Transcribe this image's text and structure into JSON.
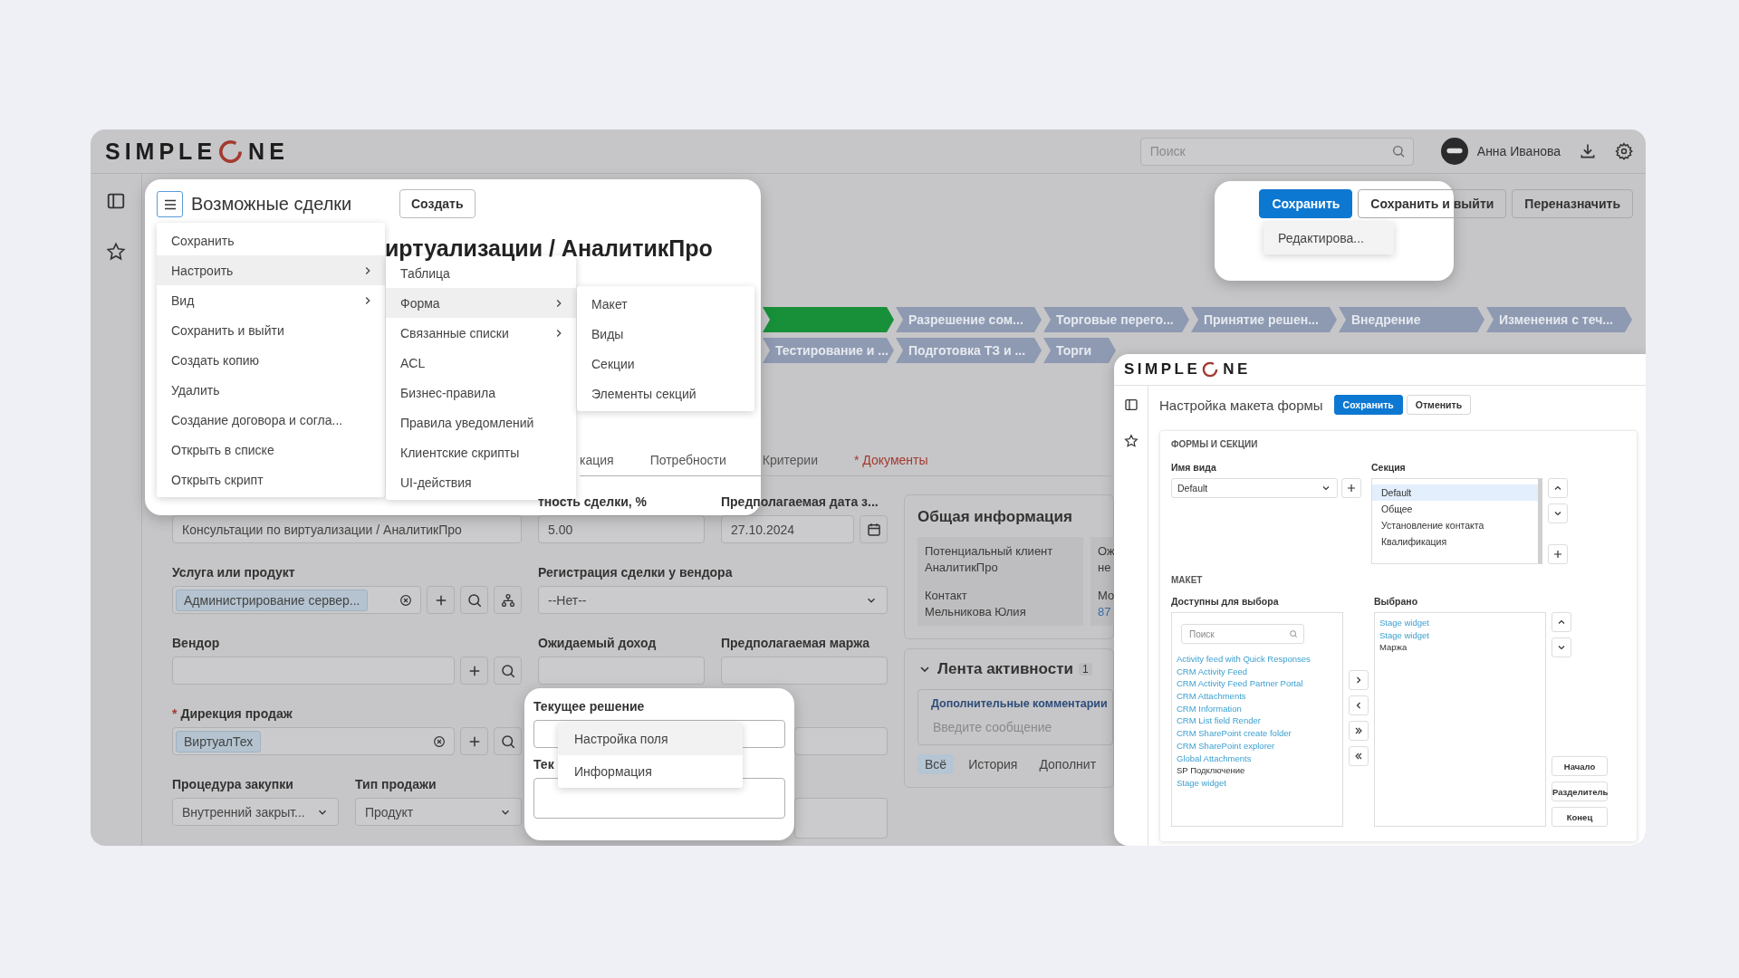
{
  "header": {
    "logo_start": "SIMPLE",
    "logo_end": "NE",
    "search_placeholder": "Поиск",
    "user_name": "Анна Иванова"
  },
  "page": {
    "title": "Возможные сделки",
    "create_button": "Создать",
    "record_title": "иртуализации / АналитикПро"
  },
  "menu": [
    {
      "label": "Сохранить",
      "selected": false,
      "submenu": false
    },
    {
      "label": "Настроить",
      "selected": true,
      "submenu": true,
      "children": [
        {
          "label": "Таблица",
          "selected": false,
          "submenu": false
        },
        {
          "label": "Форма",
          "selected": true,
          "submenu": true,
          "children": [
            {
              "label": "Макет",
              "selected": false
            },
            {
              "label": "Виды",
              "selected": false
            },
            {
              "label": "Секции",
              "selected": false
            },
            {
              "label": "Элементы секций",
              "selected": false
            }
          ]
        },
        {
          "label": "Связанные списки",
          "selected": false,
          "submenu": true
        },
        {
          "label": "ACL",
          "selected": false,
          "submenu": false
        },
        {
          "label": "Бизнес-правила",
          "selected": false,
          "submenu": false
        },
        {
          "label": "Правила уведомлений",
          "selected": false,
          "submenu": false
        },
        {
          "label": "Клиентские скрипты",
          "selected": false,
          "submenu": false
        },
        {
          "label": "UI-действия",
          "selected": false,
          "submenu": false
        }
      ]
    },
    {
      "label": "Вид",
      "selected": false,
      "submenu": true
    },
    {
      "label": "Сохранить и выйти",
      "selected": false,
      "submenu": false
    },
    {
      "label": "Создать копию",
      "selected": false,
      "submenu": false
    },
    {
      "label": "Удалить",
      "selected": false,
      "submenu": false
    },
    {
      "label": "Создание договора и согла...",
      "selected": false,
      "submenu": false
    },
    {
      "label": "Открыть в списке",
      "selected": false,
      "submenu": false
    },
    {
      "label": "Открыть скрипт",
      "selected": false,
      "submenu": false
    }
  ],
  "actions": {
    "buttons": [
      {
        "label": "Сохранить",
        "primary": true
      },
      {
        "label": "Сохранить и выйти",
        "primary": false
      },
      {
        "label": "Переназначить",
        "primary": false
      }
    ],
    "dropdown": [
      {
        "label": "Редактирова..."
      }
    ]
  },
  "stages": [
    [
      {
        "done": true
      },
      {
        "label": "Разрешение сом...",
        "done": false
      },
      {
        "label": "Торговые перего...",
        "done": false
      },
      {
        "label": "Принятие решен...",
        "done": false
      },
      {
        "label": "Внедрение",
        "done": false
      },
      {
        "label": "Изменения с теч...",
        "done": false
      }
    ],
    [
      {
        "label": "Тестирование и ...",
        "done": false
      },
      {
        "label": "Подготовка ТЗ и ...",
        "done": false
      },
      {
        "label": "Торги",
        "done": false
      }
    ]
  ],
  "tabs": [
    {
      "label": "кация",
      "required": false
    },
    {
      "label": "Потребности",
      "required": false
    },
    {
      "label": "Критерии",
      "required": false
    },
    {
      "label": "Документы",
      "required": true,
      "required_mark": "*"
    }
  ],
  "form": {
    "name": {
      "value": "Консультации по виртуализации / АналитикПро"
    },
    "probability": {
      "label": "тность сделки, %",
      "value": "5.00"
    },
    "close_date": {
      "label": "Предполагаемая дата з...",
      "value": "27.10.2024"
    },
    "service": {
      "label": "Услуга или продукт",
      "chip": "Администрирование сервер..."
    },
    "vendor_registration": {
      "label": "Регистрация сделки у вендора",
      "value": "--Нет--"
    },
    "vendor": {
      "label": "Вендор"
    },
    "expected_income": {
      "label": "Ожидаемый доход"
    },
    "margin": {
      "label": "Предполагаемая маржа"
    },
    "sales_direction": {
      "label": "Дирекция продаж",
      "required_mark": "*",
      "chip": "ВиртуалТех"
    },
    "procurement": {
      "label": "Процедура закупки",
      "value": "Внутренний закрыт..."
    },
    "sale_type": {
      "label": "Тип продажи",
      "value": "Продукт"
    }
  },
  "field_popup": {
    "label": "Текущее решение",
    "menu": [
      {
        "label": "Настройка поля",
        "selected": true
      },
      {
        "label": "Информация",
        "selected": false
      }
    ],
    "next_label": "Тек"
  },
  "general_info": {
    "title": "Общая информация",
    "cells": [
      {
        "label": "Потенциальный клиент",
        "value": "АналитикПро",
        "link": false
      },
      {
        "label": "Ож",
        "value": "не",
        "link": false
      },
      {
        "label": "Контакт",
        "value": "Мельникова Юлия",
        "link": false
      },
      {
        "label": "Мо",
        "value": "87",
        "link": true
      }
    ]
  },
  "activity": {
    "title": "Лента активности",
    "count": "1",
    "expanded": true,
    "comment_tab": "Дополнительные комментарии",
    "placeholder": "Введите сообщение",
    "filters": [
      {
        "label": "Всё",
        "selected": true
      },
      {
        "label": "История",
        "selected": false
      },
      {
        "label": "Дополнит",
        "selected": false
      }
    ]
  },
  "layout_editor": {
    "logo_start": "SIMPLE",
    "logo_end": "NE",
    "title": "Настройка макета формы",
    "save": "Сохранить",
    "cancel": "Отменить",
    "forms_heading": "ФОРМЫ И СЕКЦИИ",
    "view_label": "Имя вида",
    "view_value": "Default",
    "section_label": "Секция",
    "sections": [
      {
        "label": "Default",
        "selected": true
      },
      {
        "label": "Общее",
        "selected": false
      },
      {
        "label": "Установление контакта",
        "selected": false
      },
      {
        "label": "Квалификация",
        "selected": false
      }
    ],
    "layout_heading": "МАКЕТ",
    "available_label": "Доступны для выбора",
    "search_placeholder": "Поиск",
    "available": [
      {
        "label": "Activity feed with Quick Responses",
        "kind": "widget"
      },
      {
        "label": "CRM Activity Feed",
        "kind": "widget"
      },
      {
        "label": "CRM Activity Feed Partner Portal",
        "kind": "widget"
      },
      {
        "label": "CRM Attachments",
        "kind": "widget"
      },
      {
        "label": "CRM Information",
        "kind": "widget"
      },
      {
        "label": "CRM List field Render",
        "kind": "widget"
      },
      {
        "label": "CRM SharePoint create folder",
        "kind": "widget"
      },
      {
        "label": "CRM SharePoint explorer",
        "kind": "widget"
      },
      {
        "label": "Global Attachments",
        "kind": "widget"
      },
      {
        "label": "SP Подключение",
        "kind": "field"
      },
      {
        "label": "Stage widget",
        "kind": "widget"
      }
    ],
    "chosen_label": "Выбрано",
    "chosen": [
      {
        "label": "Stage widget",
        "kind": "widget"
      },
      {
        "label": "Stage widget",
        "kind": "widget"
      },
      {
        "label": "Маржа",
        "kind": "field"
      }
    ],
    "buttons": [
      "Начало",
      "Разделитель",
      "Конец"
    ]
  }
}
